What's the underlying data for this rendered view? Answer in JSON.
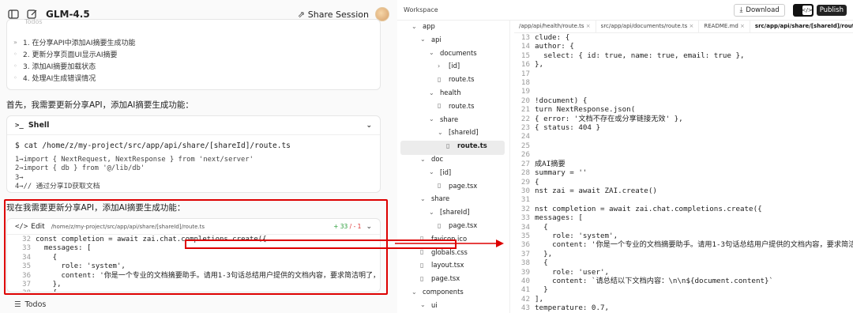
{
  "app": {
    "title": "GLM-4.5",
    "share_label": "Share Session"
  },
  "todos": {
    "faded_header": "Todos",
    "items": [
      {
        "mark": "»",
        "text": "1. 在分享API中添加AI摘要生成功能"
      },
      {
        "mark": "◦",
        "text": "2. 更新分享页面UI显示AI摘要"
      },
      {
        "mark": "◦",
        "text": "3. 添加AI摘要加载状态"
      },
      {
        "mark": "◦",
        "text": "4. 处理AI生成错误情况"
      }
    ]
  },
  "messages": {
    "first": "首先，我需要更新分享API，添加AI摘要生成功能：",
    "second": "现在我需要更新分享API，添加AI摘要生成功能："
  },
  "shell": {
    "title": "Shell",
    "command": "$ cat /home/z/my-project/src/app/api/share/[shareId]/route.ts",
    "lines": [
      "1→import { NextRequest, NextResponse } from 'next/server'",
      "2→import { db } from '@/lib/db'",
      "3→",
      "4→// 通过分享ID获取文档"
    ]
  },
  "edit": {
    "label": "Edit",
    "path": "/home/z/my-project/src/app/api/share/[shareId]/route.ts",
    "added": "+ 33",
    "removed": "/ - 1",
    "lines": [
      {
        "n": "32",
        "t": "const completion = await zai.chat.completions.create({"
      },
      {
        "n": "33",
        "t": "  messages: ["
      },
      {
        "n": "34",
        "t": "    {"
      },
      {
        "n": "35",
        "t": "      role: 'system',"
      },
      {
        "n": "36",
        "t": "      content: '你是一个专业的文档摘要助手。请用1-3句话总结用户提供的文档内容，要求简洁明了，突出"
      },
      {
        "n": "37",
        "t": "    },"
      },
      {
        "n": "38",
        "t": "    {"
      }
    ]
  },
  "bottom": {
    "todos_label": "Todos"
  },
  "workspace": {
    "label": "Workspace",
    "download_label": "Download",
    "publish_label": "Publish"
  },
  "tree": [
    {
      "name": "app",
      "type": "folder-open",
      "depth": 0
    },
    {
      "name": "api",
      "type": "folder-open",
      "depth": 1
    },
    {
      "name": "documents",
      "type": "folder-open",
      "depth": 2
    },
    {
      "name": "[id]",
      "type": "folder-closed",
      "depth": 3
    },
    {
      "name": "route.ts",
      "type": "file",
      "depth": 3
    },
    {
      "name": "health",
      "type": "folder-open",
      "depth": 2
    },
    {
      "name": "route.ts",
      "type": "file",
      "depth": 3
    },
    {
      "name": "share",
      "type": "folder-open",
      "depth": 2
    },
    {
      "name": "[shareId]",
      "type": "folder-open",
      "depth": 3
    },
    {
      "name": "route.ts",
      "type": "file",
      "depth": 4,
      "selected": true
    },
    {
      "name": "doc",
      "type": "folder-open",
      "depth": 1
    },
    {
      "name": "[id]",
      "type": "folder-open",
      "depth": 2
    },
    {
      "name": "page.tsx",
      "type": "file",
      "depth": 3
    },
    {
      "name": "share",
      "type": "folder-open",
      "depth": 1
    },
    {
      "name": "[shareId]",
      "type": "folder-open",
      "depth": 2
    },
    {
      "name": "page.tsx",
      "type": "file",
      "depth": 3
    },
    {
      "name": "favicon.ico",
      "type": "file",
      "depth": 1
    },
    {
      "name": "globals.css",
      "type": "file",
      "depth": 1
    },
    {
      "name": "layout.tsx",
      "type": "file",
      "depth": 1
    },
    {
      "name": "page.tsx",
      "type": "file",
      "depth": 1
    },
    {
      "name": "components",
      "type": "folder-open",
      "depth": 0
    },
    {
      "name": "ui",
      "type": "folder-open",
      "depth": 1
    }
  ],
  "tabs": [
    {
      "label": "/app/api/health/route.ts",
      "active": false
    },
    {
      "label": "src/app/api/documents/route.ts",
      "active": false
    },
    {
      "label": "README.md",
      "active": false
    },
    {
      "label": "src/app/api/share/[shareId]/route.ts",
      "active": true
    }
  ],
  "editor": [
    {
      "n": "13",
      "t": "clude: {"
    },
    {
      "n": "14",
      "t": "author: {"
    },
    {
      "n": "15",
      "t": "  select: { id: true, name: true, email: true },"
    },
    {
      "n": "16",
      "t": "},"
    },
    {
      "n": "17",
      "t": ""
    },
    {
      "n": "18",
      "t": ""
    },
    {
      "n": "19",
      "t": ""
    },
    {
      "n": "20",
      "t": "!document) {"
    },
    {
      "n": "21",
      "t": "turn NextResponse.json("
    },
    {
      "n": "22",
      "t": "{ error: '文档不存在或分享链接无效' },"
    },
    {
      "n": "23",
      "t": "{ status: 404 }"
    },
    {
      "n": "24",
      "t": ""
    },
    {
      "n": "25",
      "t": ""
    },
    {
      "n": "26",
      "t": ""
    },
    {
      "n": "27",
      "t": "成AI摘要"
    },
    {
      "n": "28",
      "t": "summary = ''"
    },
    {
      "n": "29",
      "t": "{"
    },
    {
      "n": "30",
      "t": "nst zai = await ZAI.create()"
    },
    {
      "n": "31",
      "t": ""
    },
    {
      "n": "32",
      "t": "nst completion = await zai.chat.completions.create({"
    },
    {
      "n": "33",
      "t": "messages: ["
    },
    {
      "n": "34",
      "t": "  {"
    },
    {
      "n": "35",
      "t": "    role: 'system',"
    },
    {
      "n": "36",
      "t": "    content: '你是一个专业的文档摘要助手。请用1-3句话总结用户提供的文档内容，要求简洁明了，突出"
    },
    {
      "n": "37",
      "t": "  },"
    },
    {
      "n": "38",
      "t": "  {"
    },
    {
      "n": "39",
      "t": "    role: 'user',"
    },
    {
      "n": "40",
      "t": "    content: `请总结以下文档内容：\\n\\n${document.content}`"
    },
    {
      "n": "41",
      "t": "  }"
    },
    {
      "n": "42",
      "t": "],"
    },
    {
      "n": "43",
      "t": "temperature: 0.7,"
    }
  ],
  "colors": {
    "highlight": "#dd0000",
    "accent_add": "#2a9d3a",
    "accent_remove": "#d33"
  }
}
